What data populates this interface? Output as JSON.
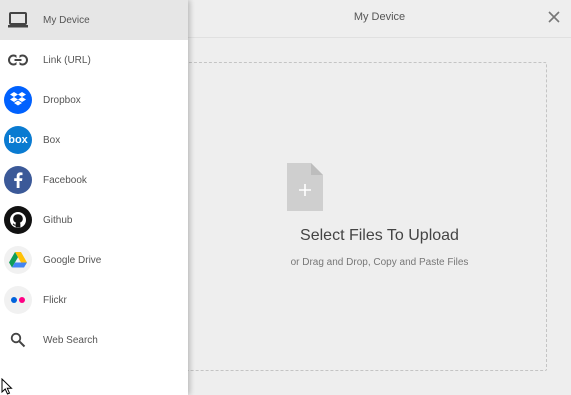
{
  "header": {
    "title": "My Device"
  },
  "dropzone": {
    "title": "Select Files To Upload",
    "subtitle": "or Drag and Drop, Copy and Paste Files"
  },
  "sidebar": {
    "items": [
      {
        "label": "My Device",
        "icon": "laptop-icon",
        "active": true
      },
      {
        "label": "Link (URL)",
        "icon": "link-icon"
      },
      {
        "label": "Dropbox",
        "icon": "dropbox-icon",
        "color": "#0061fe"
      },
      {
        "label": "Box",
        "icon": "box-icon",
        "color": "#0a7bd1",
        "logo_text": "box"
      },
      {
        "label": "Facebook",
        "icon": "facebook-icon",
        "color": "#3b5998"
      },
      {
        "label": "Github",
        "icon": "github-icon",
        "color": "#111111"
      },
      {
        "label": "Google Drive",
        "icon": "google-drive-icon"
      },
      {
        "label": "Flickr",
        "icon": "flickr-icon",
        "colors": [
          "#0063dc",
          "#ff0084"
        ]
      },
      {
        "label": "Web Search",
        "icon": "search-icon"
      }
    ]
  }
}
